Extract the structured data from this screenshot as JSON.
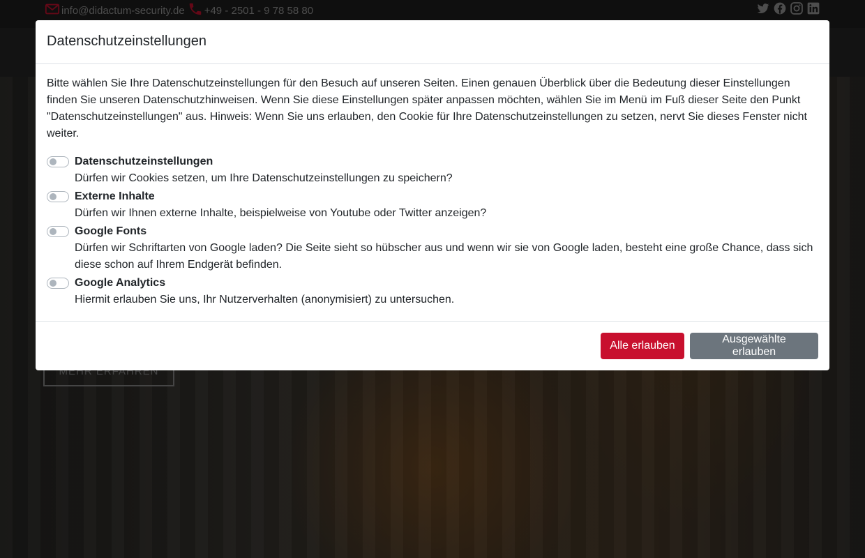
{
  "topbar": {
    "email": "info@didactum-security.de",
    "phone": "+49 - 2501 - 9 78 58 80",
    "icons": {
      "email": "mail-icon",
      "phone": "phone-icon",
      "social": [
        "twitter-icon",
        "facebook-icon",
        "instagram-icon",
        "linkedin-icon"
      ]
    },
    "icon_color": "#c8102e"
  },
  "hero": {
    "cta_label": "MEHR ERFAHREN"
  },
  "modal": {
    "title": "Datenschutzeinstellungen",
    "intro": "Bitte wählen Sie Ihre Datenschutzeinstellungen für den Besuch auf unseren Seiten. Einen genauen Überblick über die Bedeutung dieser Einstellungen finden Sie unseren Datenschutzhinweisen. Wenn Sie diese Einstellungen später anpassen möchten, wählen Sie im Menü im Fuß dieser Seite den Punkt \"Datenschutzeinstellungen\" aus. Hinweis: Wenn Sie uns erlauben, den Cookie für Ihre Datenschutzeinstellungen zu setzen, nervt Sie dieses Fenster nicht weiter.",
    "options": [
      {
        "label": "Datenschutzeinstellungen",
        "desc": "Dürfen wir Cookies setzen, um Ihre Datenschutzeinstellungen zu speichern?",
        "checked": false
      },
      {
        "label": "Externe Inhalte",
        "desc": "Dürfen wir Ihnen externe Inhalte, beispielweise von Youtube oder Twitter anzeigen?",
        "checked": false
      },
      {
        "label": "Google Fonts",
        "desc": "Dürfen wir Schriftarten von Google laden? Die Seite sieht so hübscher aus und wenn wir sie von Google laden, besteht eine große Chance, dass sich diese schon auf Ihrem Endgerät befinden.",
        "checked": false
      },
      {
        "label": "Google Analytics",
        "desc": "Hiermit erlauben Sie uns, Ihr Nutzerverhalten (anonymisiert) zu untersuchen.",
        "checked": false
      }
    ],
    "buttons": {
      "allow_all": "Alle erlauben",
      "allow_selected": "Ausgewählte erlauben"
    },
    "colors": {
      "primary": "#c8102e",
      "secondary": "#6c757d"
    }
  }
}
